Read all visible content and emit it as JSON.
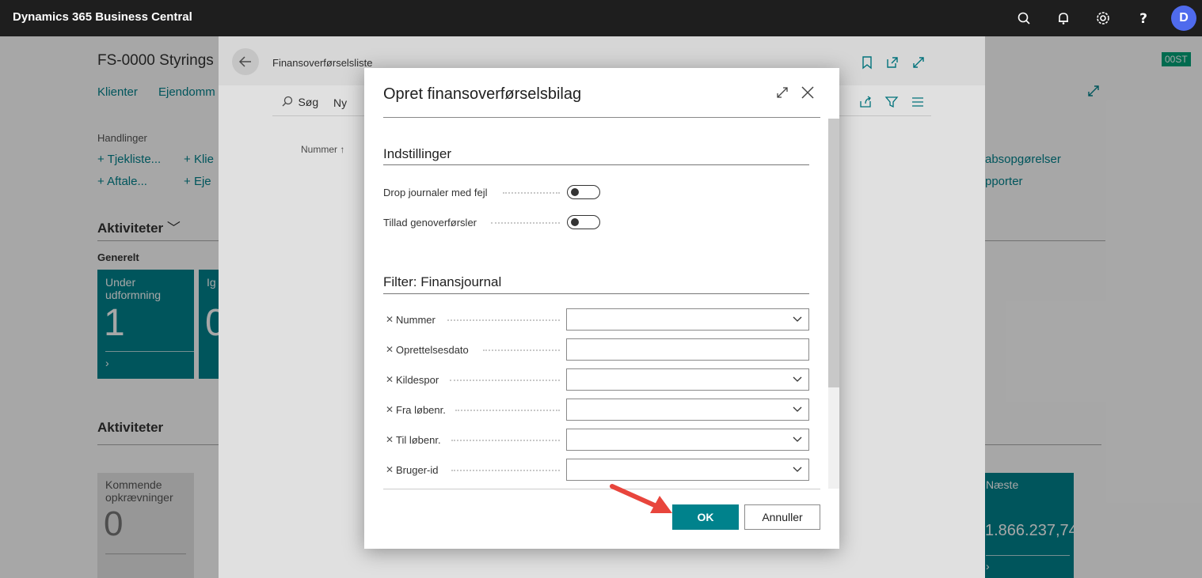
{
  "topbar": {
    "title": "Dynamics 365 Business Central",
    "avatar_initial": "D",
    "icons": [
      "search-icon",
      "bell-icon",
      "gear-icon",
      "help-icon"
    ]
  },
  "background_page": {
    "title": "FS-0000 Styrings",
    "nav": [
      "Klienter",
      "Ejendomm"
    ],
    "actions_heading": "Handlinger",
    "actions": [
      "Tjekliste...",
      "Klie",
      "Aftale...",
      "Eje"
    ],
    "activities_heading": "Aktiviteter",
    "general_label": "Generelt",
    "tiles": [
      {
        "label": "Under udformning",
        "value": "1"
      },
      {
        "label": "Ig",
        "value": "0"
      }
    ],
    "activities2_heading": "Aktiviteter",
    "tile_upcoming": {
      "label": "Kommende opkrævninger",
      "value": "0"
    },
    "right_links": [
      "absopgørelser",
      "pporter"
    ],
    "tile_next": {
      "label": "Næste",
      "value": "1.866.237,74"
    },
    "badge": "00ST"
  },
  "list_page": {
    "breadcrumb": "Finansoverførselsliste",
    "search": "Søg",
    "new": "Ny",
    "column_header": "Nummer ↑"
  },
  "dialog": {
    "title": "Opret finansoverførselsbilag",
    "settings_section": "Indstillinger",
    "toggles": [
      {
        "label": "Drop journaler med fejl",
        "value": false
      },
      {
        "label": "Tillad genoverførsler",
        "value": false
      }
    ],
    "filter_section": "Filter: Finansjournal",
    "filters": [
      {
        "label": "Nummer",
        "value": "",
        "dropdown": true
      },
      {
        "label": "Oprettelsesdato",
        "value": "",
        "dropdown": false
      },
      {
        "label": "Kildespor",
        "value": "",
        "dropdown": true
      },
      {
        "label": "Fra løbenr.",
        "value": "",
        "dropdown": true
      },
      {
        "label": "Til løbenr.",
        "value": "",
        "dropdown": true
      },
      {
        "label": "Bruger-id",
        "value": "",
        "dropdown": true
      }
    ],
    "ok_label": "OK",
    "cancel_label": "Annuller"
  },
  "colors": {
    "accent": "#00828c",
    "topbar": "#1e1e1e",
    "avatar": "#4f6bed",
    "arrow": "#e8453c"
  }
}
